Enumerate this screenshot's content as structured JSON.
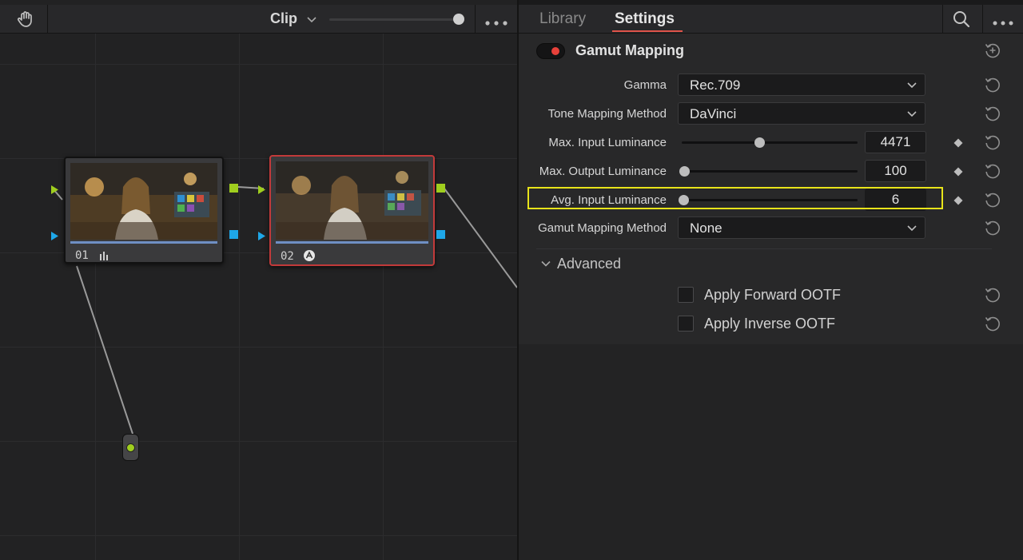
{
  "node_editor": {
    "clip_label": "Clip",
    "nodes": [
      {
        "label": "01",
        "fx": "bars"
      },
      {
        "label": "02",
        "fx": "aces"
      }
    ]
  },
  "inspector": {
    "tabs": [
      {
        "label": "Library",
        "active": false
      },
      {
        "label": "Settings",
        "active": true
      }
    ],
    "section": {
      "title": "Gamut Mapping",
      "enabled": true
    },
    "rows": {
      "gamma": {
        "label": "Gamma",
        "value": "Rec.709"
      },
      "tone_mapping": {
        "label": "Tone Mapping Method",
        "value": "DaVinci"
      },
      "max_input": {
        "label": "Max. Input Luminance",
        "value": "4471"
      },
      "max_output": {
        "label": "Max. Output Luminance",
        "value": "100"
      },
      "avg_input": {
        "label": "Avg. Input Luminance",
        "value": "6"
      },
      "gamut_method": {
        "label": "Gamut Mapping Method",
        "value": "None"
      }
    },
    "advanced": {
      "label": "Advanced",
      "options": [
        {
          "label": "Apply Forward OOTF",
          "checked": false
        },
        {
          "label": "Apply Inverse OOTF",
          "checked": false
        }
      ]
    }
  },
  "colors": {
    "accent_red": "#e8413a",
    "highlight_yellow": "#e8e41a",
    "port_green": "#9fce1e",
    "port_blue": "#1ea7e8"
  }
}
